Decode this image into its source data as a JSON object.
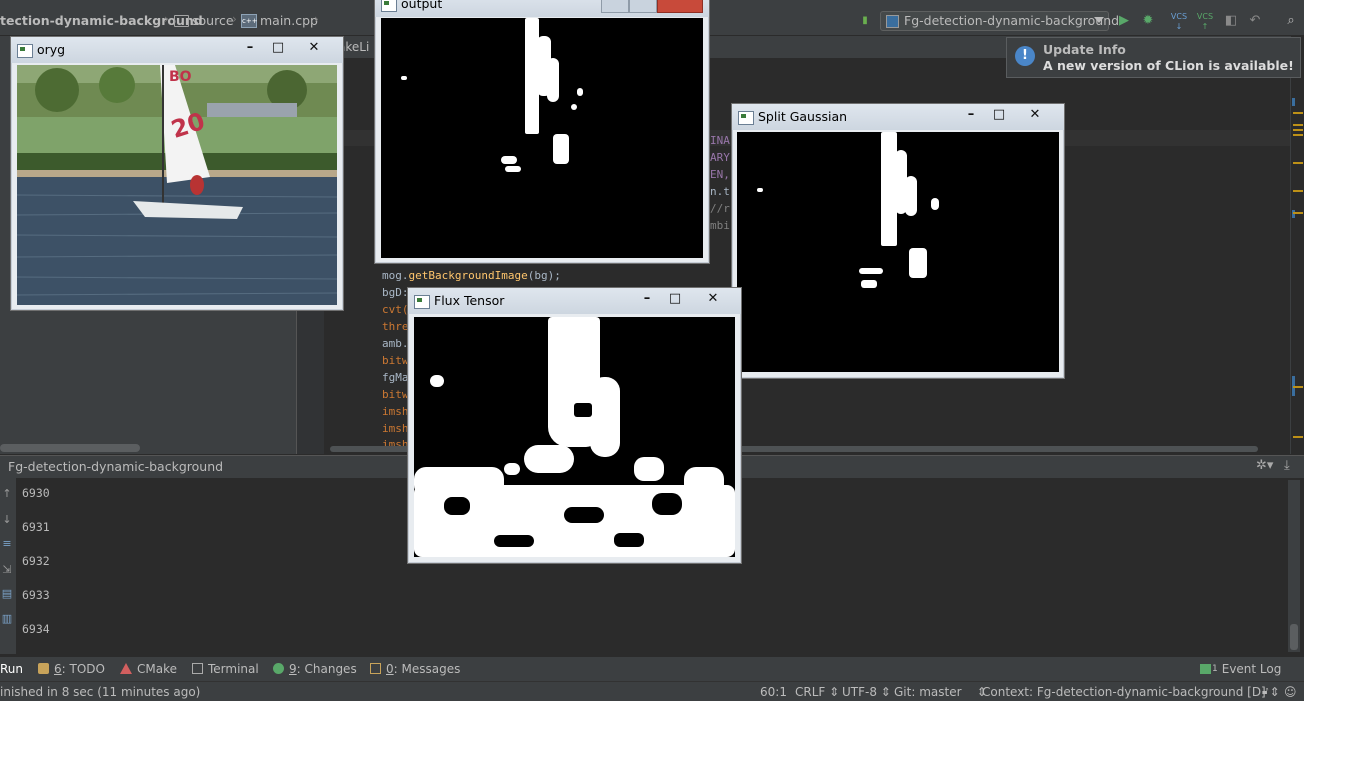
{
  "breadcrumb": {
    "project": "tection-dynamic-background",
    "folder": "source",
    "file": "main.cpp"
  },
  "toolbar": {
    "run_config": "Fg-detection-dynamic-background",
    "vcs1": "VCS",
    "vcs2": "VCS"
  },
  "editor": {
    "partial_tab": "akeLi",
    "code_fragments": [
      "INA",
      "ARY",
      "EN,",
      "n.t",
      "//r",
      "mbi"
    ],
    "code_lines": [
      {
        "obj": "mog.",
        "call": "getBackgroundImage",
        "rest": "(bg);"
      },
      {
        "obj": "bgD:",
        "call": "",
        "rest": ""
      },
      {
        "obj": "cvt(",
        "call": "",
        "rest": ""
      },
      {
        "obj": "thre",
        "call": "",
        "rest": ""
      },
      {
        "obj": "amb.",
        "call": "",
        "rest": ""
      },
      {
        "obj": "bitw",
        "call": "",
        "rest": ""
      },
      {
        "obj": "fgMa",
        "call": "",
        "rest": ""
      },
      {
        "obj": "bitw",
        "call": "",
        "rest": ""
      },
      {
        "obj": "imsh",
        "call": "",
        "rest": ""
      },
      {
        "obj": "imsh",
        "call": "",
        "rest": ""
      },
      {
        "obj": "imsh",
        "call": "",
        "rest": ""
      }
    ]
  },
  "notification": {
    "title": "Update Info",
    "body": "A new version of CLion is available!"
  },
  "run_panel": {
    "title": "Fg-detection-dynamic-background",
    "lines": [
      "6930",
      "6931",
      "6932",
      "6933",
      "6934"
    ]
  },
  "tools": {
    "run": "Run",
    "todo_num": "6",
    "todo": ": TODO",
    "cmake": "CMake",
    "terminal": "Terminal",
    "changes_num": "9",
    "changes": ": Changes",
    "messages_num": "0",
    "messages": ": Messages",
    "event_log": "Event Log",
    "event_count": "1"
  },
  "status": {
    "message": "inished in 8 sec (11 minutes ago)",
    "position": "60:1",
    "line_sep": "CRLF",
    "encoding": "UTF-8",
    "git": "Git: master",
    "context": "Context: Fg-detection-dynamic-background [D]"
  },
  "windows": {
    "oryg": {
      "title": "oryg",
      "sail_text_1": "BO",
      "sail_text_2": "20"
    },
    "output": {
      "title": "output"
    },
    "split": {
      "title": "Split Gaussian"
    },
    "flux": {
      "title": "Flux Tensor"
    },
    "minimize": "–",
    "maximize": "□",
    "close": "✕"
  }
}
